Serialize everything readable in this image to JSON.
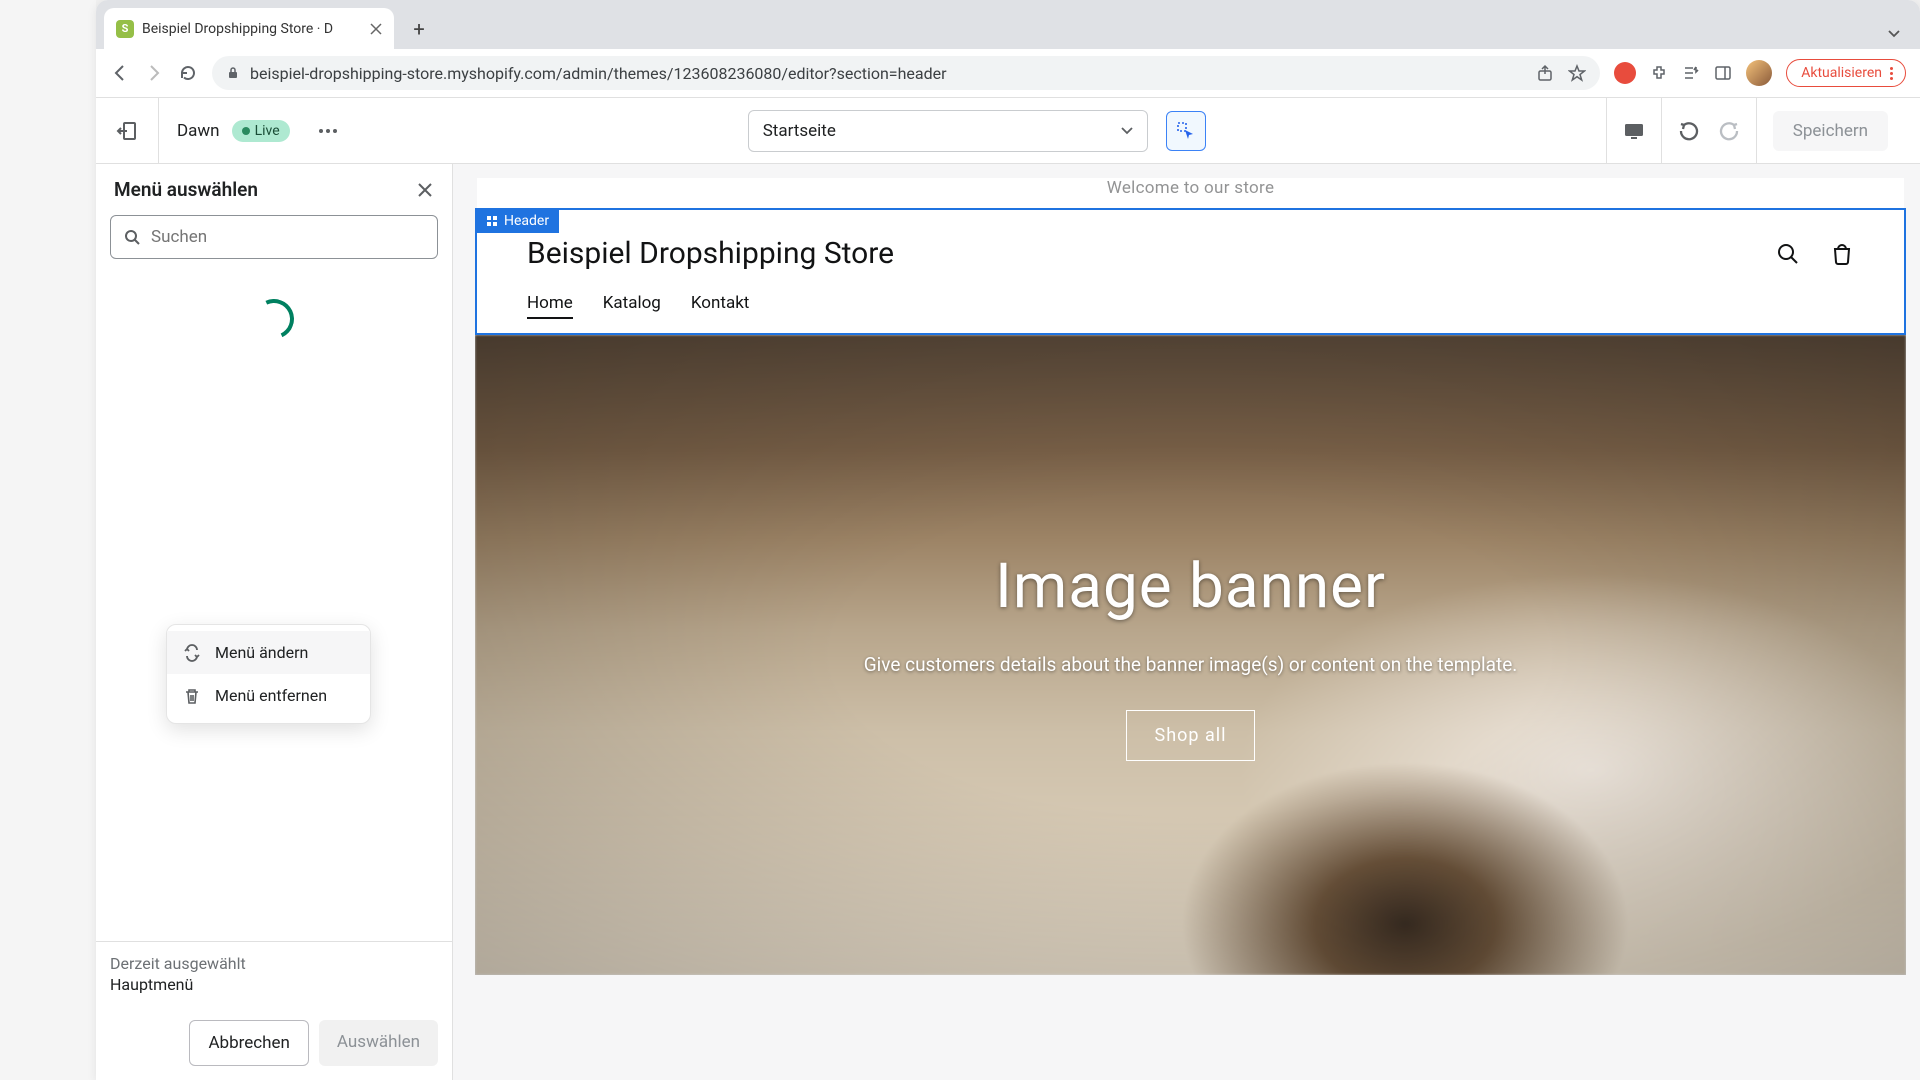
{
  "browser": {
    "tab_title": "Beispiel Dropshipping Store · D",
    "url": "beispiel-dropshipping-store.myshopify.com/admin/themes/123608236080/editor?section=header",
    "update_label": "Aktualisieren"
  },
  "topbar": {
    "theme_name": "Dawn",
    "live_badge": "Live",
    "page_select": "Startseite",
    "save_label": "Speichern"
  },
  "panel": {
    "title": "Menü auswählen",
    "search_placeholder": "Suchen",
    "popup": {
      "change": "Menü ändern",
      "remove": "Menü entfernen"
    },
    "footer": {
      "current_label": "Derzeit ausgewählt",
      "current_value": "Hauptmenü",
      "cancel": "Abbrechen",
      "select": "Auswählen"
    }
  },
  "preview": {
    "announcement": "Welcome to our store",
    "header_tag": "Header",
    "store_title": "Beispiel Dropshipping Store",
    "nav": [
      "Home",
      "Katalog",
      "Kontakt"
    ],
    "banner": {
      "title": "Image banner",
      "subtitle": "Give customers details about the banner image(s) or content on the template.",
      "cta": "Shop all"
    }
  }
}
